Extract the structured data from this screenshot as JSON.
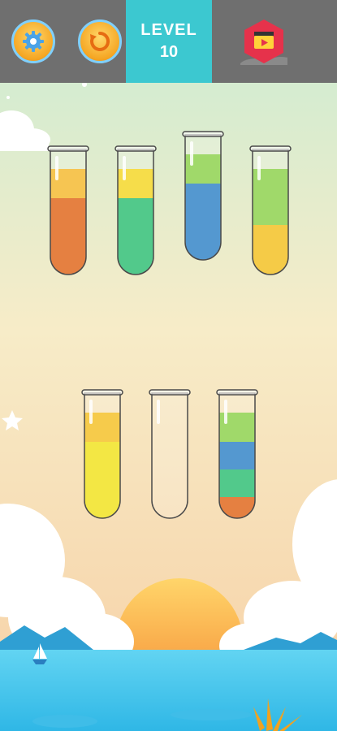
{
  "header": {
    "settings_icon": "gear-icon",
    "restart_icon": "restart-icon",
    "level_label": "LEVEL",
    "level_number": "10",
    "video_icon": "video-clapper-icon"
  },
  "tubes": [
    {
      "id": "1",
      "layers": [
        "#f4b92c",
        "#e06418"
      ]
    },
    {
      "id": "2",
      "layers": [
        "#f5d623",
        "#2dbe72"
      ]
    },
    {
      "id": "3",
      "layers": [
        "#8cd14a",
        "#2f82c6"
      ]
    },
    {
      "id": "4",
      "layers": [
        "#8cd14a",
        "#f3c01f"
      ]
    },
    {
      "id": "5",
      "layers": [
        "#f5c024",
        "#f1e21c"
      ]
    },
    {
      "id": "6",
      "layers": []
    },
    {
      "id": "7",
      "layers": [
        "#8cd14a",
        "#2f82c6",
        "#2dbe72",
        "#e06418"
      ]
    }
  ],
  "colors": {
    "topbar": "#6f6f6f",
    "level_panel": "#3cc8d0",
    "video_button": "#e6324b",
    "sky_top": "#c9ecd3",
    "sky_bottom": "#f7d0a5",
    "sun": "#f59a3c",
    "sea": "#4fc6ea"
  }
}
